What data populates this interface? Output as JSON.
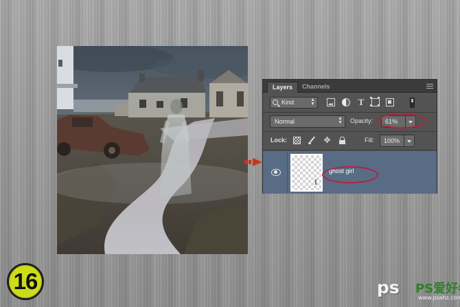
{
  "panel": {
    "tabs": [
      {
        "label": "Layers",
        "active": true
      },
      {
        "label": "Channels",
        "active": false
      }
    ],
    "filter": {
      "kind_label": "Kind"
    },
    "blend_mode": "Normal",
    "opacity_label": "Opacity:",
    "opacity_value": "61%",
    "lock_label": "Lock:",
    "fill_label": "Fill:",
    "fill_value": "100%",
    "layer": {
      "name": "ghost girl",
      "visible": true
    }
  },
  "step_number": "16",
  "watermark": {
    "brand": "ps",
    "chinese": "PS爱好者",
    "url": "www.psahz.com"
  },
  "colors": {
    "highlight": "#b4213a",
    "badge": "#ccdc1a",
    "layer_selected": "#586c85",
    "panel_bg": "#535353"
  }
}
